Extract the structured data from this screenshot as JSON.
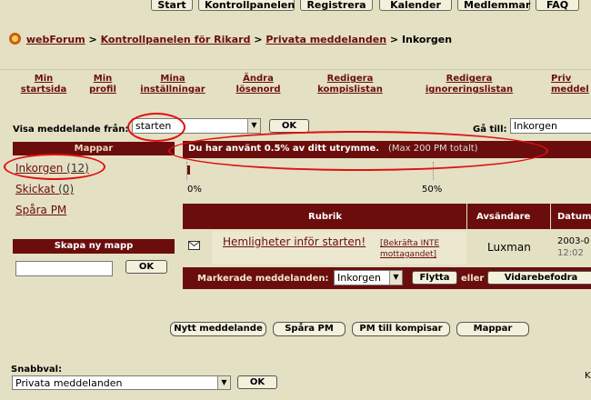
{
  "topnav": [
    "Start",
    "Kontrollpanelen",
    "Registrera",
    "Kalender",
    "Medlemmar",
    "FAQ"
  ],
  "breadcrumb": {
    "logo_icon": "forum-logo-icon",
    "items": [
      "webForum",
      "Kontrollpanelen för Rikard",
      "Privata meddelanden"
    ],
    "separator": ">",
    "current": "Inkorgen"
  },
  "subnav": [
    {
      "line1": "Min",
      "line2": "startsida"
    },
    {
      "line1": "Min",
      "line2": "profil"
    },
    {
      "line1": "Mina",
      "line2": "inställningar"
    },
    {
      "line1": "Ändra",
      "line2": "lösenord"
    },
    {
      "line1": "Redigera",
      "line2": "kompislistan"
    },
    {
      "line1": "Redigera",
      "line2": "ignoreringslistan"
    },
    {
      "line1": "Priv",
      "line2": "meddel"
    }
  ],
  "filter": {
    "label": "Visa meddelande från:",
    "value": "starten",
    "ok": "OK",
    "goto_label": "Gå till:",
    "goto_value": "Inkorgen"
  },
  "sidebar": {
    "header": "Mappar",
    "folders": [
      {
        "name": "Inkorgen",
        "count": "(12)"
      },
      {
        "name": "Skickat",
        "count": "(0)"
      },
      {
        "name": "Spåra PM",
        "count": ""
      }
    ],
    "new_folder_header": "Skapa ny mapp",
    "new_folder_value": "",
    "ok": "OK"
  },
  "usage": {
    "text": "Du har använt 0.5% av ditt utrymme.",
    "max": "(Max 200 PM totalt)",
    "tick0": "0%",
    "tick50": "50%",
    "used_fraction": 0.005
  },
  "table": {
    "headers": [
      "Rubrik",
      "Avsändare",
      "Datum"
    ],
    "rows": [
      {
        "icon": "envelope-icon",
        "subject": "Hemligheter inför starten!",
        "confirm": "[Bekräfta INTE mottagandet]",
        "sender": "Luxman",
        "date": "2003-0",
        "time": "12:02"
      }
    ]
  },
  "actions": {
    "label": "Markerade meddelanden:",
    "folder_value": "Inkorgen",
    "move": "Flytta",
    "or": "eller",
    "forward": "Vidarebefodra"
  },
  "bottom_buttons": [
    "Nytt meddelande",
    "Spåra PM",
    "PM till kompisar",
    "Mappar"
  ],
  "quick": {
    "label": "Snabbval:",
    "value": "Privata meddelanden",
    "ok": "OK",
    "right_text": "K"
  },
  "colors": {
    "accent": "#6b0d0d",
    "background": "#e4e0c4",
    "highlight": "#e01010"
  }
}
